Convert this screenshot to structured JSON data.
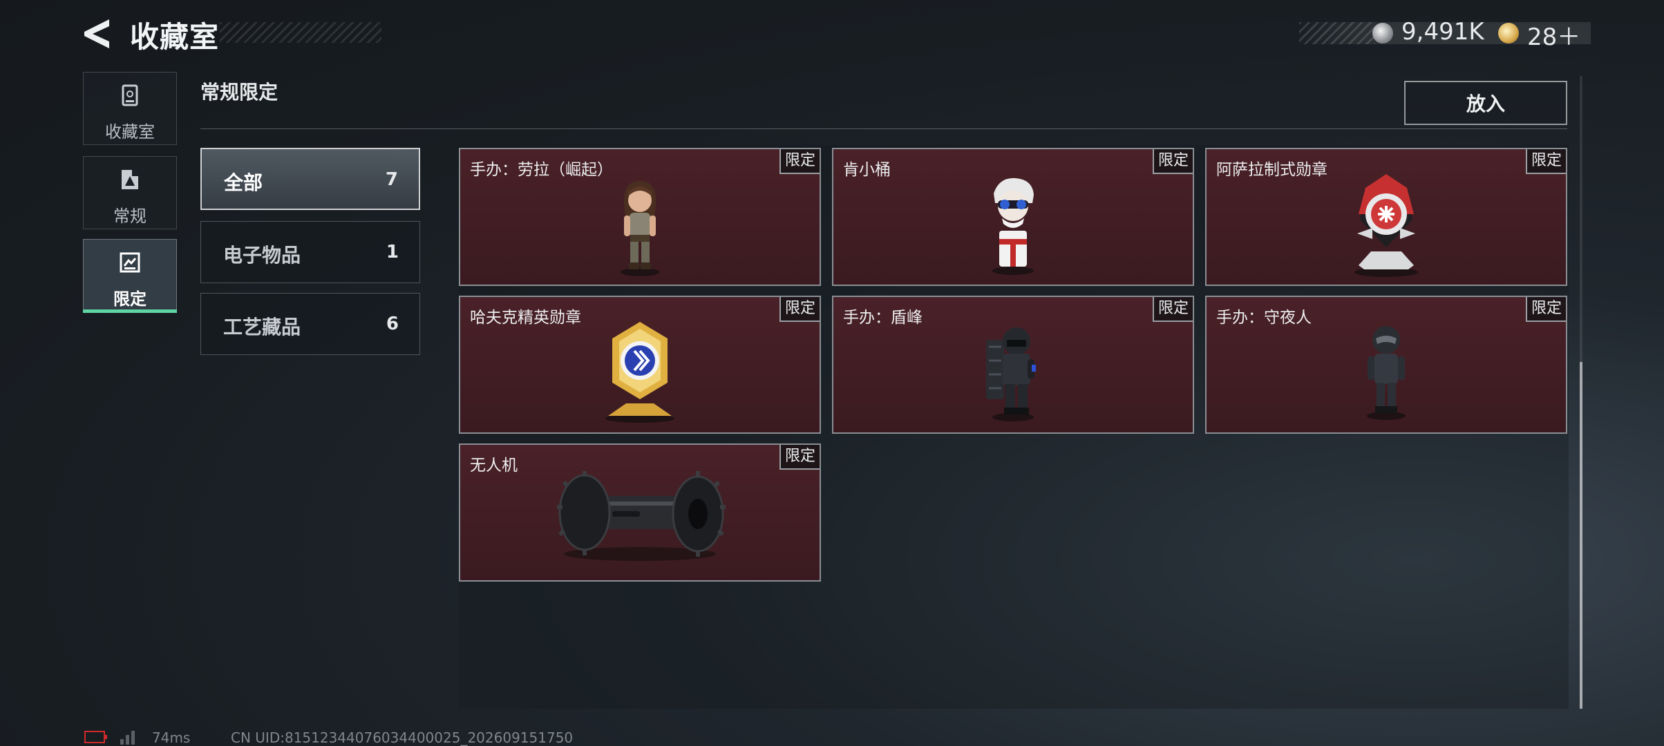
{
  "header": {
    "title": "收藏室",
    "currencies": [
      {
        "icon": "silver-coin-icon",
        "value": "9,491K"
      },
      {
        "icon": "gold-coin-icon",
        "value": "28＋"
      }
    ]
  },
  "rail": {
    "items": [
      {
        "label": "收藏室",
        "icon": "collection-room-icon",
        "selected": false
      },
      {
        "label": "常规",
        "icon": "regular-icon",
        "selected": false
      },
      {
        "label": "限定",
        "icon": "limited-icon",
        "selected": true
      }
    ]
  },
  "section": {
    "title": "常规限定",
    "put_in_label": "放入"
  },
  "filters": [
    {
      "label": "全部",
      "count": "7",
      "selected": true
    },
    {
      "label": "电子物品",
      "count": "1",
      "selected": false
    },
    {
      "label": "工艺藏品",
      "count": "6",
      "selected": false
    }
  ],
  "items": [
    {
      "name": "手办：劳拉（崛起）",
      "tag": "限定"
    },
    {
      "name": "肯小桶",
      "tag": "限定"
    },
    {
      "name": "阿萨拉制式勋章",
      "tag": "限定"
    },
    {
      "name": "哈夫克精英勋章",
      "tag": "限定"
    },
    {
      "name": "手办：盾峰",
      "tag": "限定"
    },
    {
      "name": "手办：守夜人",
      "tag": "限定"
    },
    {
      "name": "无人机",
      "tag": "限定"
    }
  ],
  "status": {
    "ping": "74ms",
    "uid": "CN UID:81512344076034400025_202609151750"
  },
  "colors": {
    "accent": "#5fd6a4",
    "card_bg": "#3a1a20",
    "card_border": "#8a8f94"
  }
}
